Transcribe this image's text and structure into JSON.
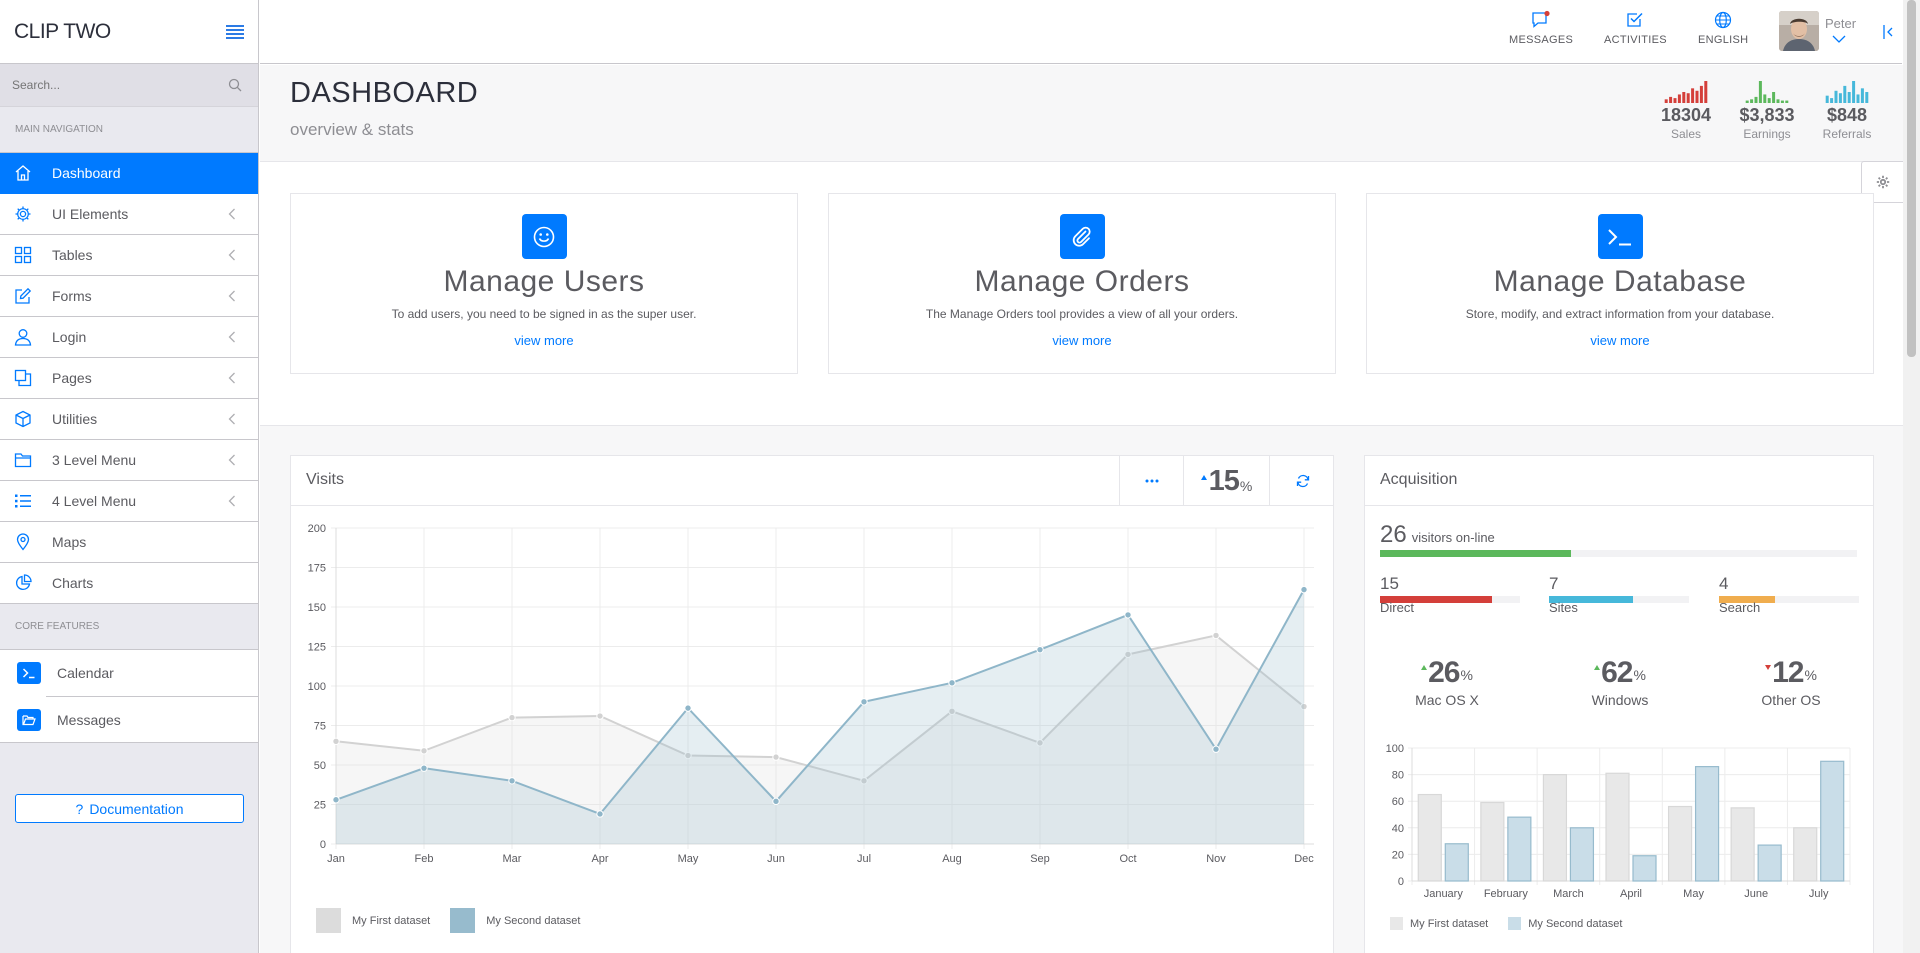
{
  "app": {
    "brand": "CLIP TWO"
  },
  "sidebar": {
    "search_placeholder": "Search...",
    "main_nav_heading": "MAIN NAVIGATION",
    "items": [
      {
        "label": "Dashboard",
        "icon": "home-icon",
        "active": true
      },
      {
        "label": "UI Elements",
        "icon": "gear-icon"
      },
      {
        "label": "Tables",
        "icon": "grid-icon"
      },
      {
        "label": "Forms",
        "icon": "pencil-icon"
      },
      {
        "label": "Login",
        "icon": "user-icon"
      },
      {
        "label": "Pages",
        "icon": "pages-icon"
      },
      {
        "label": "Utilities",
        "icon": "cube-icon"
      },
      {
        "label": "3 Level Menu",
        "icon": "folder-icon"
      },
      {
        "label": "4 Level Menu",
        "icon": "list-icon"
      },
      {
        "label": "Maps",
        "icon": "map-pin-icon"
      },
      {
        "label": "Charts",
        "icon": "pie-chart-icon"
      }
    ],
    "core_heading": "CORE FEATURES",
    "core_items": [
      {
        "label": "Calendar",
        "icon": "terminal-icon"
      },
      {
        "label": "Messages",
        "icon": "folder-open-icon"
      }
    ],
    "doc_button": "Documentation"
  },
  "topbar": {
    "messages": "MESSAGES",
    "activities": "ACTIVITIES",
    "english": "ENGLISH",
    "user_name": "Peter"
  },
  "page": {
    "title": "DASHBOARD",
    "subtitle": "overview & stats",
    "mini_stats": [
      {
        "value": "18304",
        "label": "Sales",
        "color": "#d43f3a",
        "bars": [
          3,
          5,
          4,
          7,
          9,
          8,
          12,
          10,
          14,
          18
        ]
      },
      {
        "value": "$3,833",
        "label": "Earnings",
        "color": "#5cb85c",
        "bars": [
          2,
          3,
          5,
          18,
          7,
          4,
          9,
          3,
          2,
          2
        ]
      },
      {
        "value": "$848",
        "label": "Referrals",
        "color": "#46b8da",
        "bars": [
          6,
          4,
          10,
          8,
          14,
          9,
          18,
          7,
          12,
          9
        ]
      }
    ]
  },
  "features": [
    {
      "title": "Manage Users",
      "desc": "To add users, you need to be signed in as the super user.",
      "link": "view more",
      "icon": "smile-icon"
    },
    {
      "title": "Manage Orders",
      "desc": "The Manage Orders tool provides a view of all your orders.",
      "link": "view more",
      "icon": "paperclip-icon"
    },
    {
      "title": "Manage Database",
      "desc": "Store, modify, and extract information from your database.",
      "link": "view more",
      "icon": "terminal-icon"
    }
  ],
  "visits": {
    "title": "Visits",
    "percent": "15",
    "percent_sign": "%"
  },
  "acquisition": {
    "title": "Acquisition",
    "online_count": "26",
    "online_label": "visitors on-line",
    "online_fraction": 0.4,
    "sources": [
      {
        "value": "15",
        "label": "Direct",
        "color": "#d43f3a",
        "fraction": 0.8
      },
      {
        "value": "7",
        "label": "Sites",
        "color": "#46b8da",
        "fraction": 0.6
      },
      {
        "value": "4",
        "label": "Search",
        "color": "#f0ad4e",
        "fraction": 0.4
      }
    ],
    "os": [
      {
        "value": "26",
        "pct": "%",
        "label": "Mac OS X",
        "trend": "up"
      },
      {
        "value": "62",
        "pct": "%",
        "label": "Windows",
        "trend": "up"
      },
      {
        "value": "12",
        "pct": "%",
        "label": "Other OS",
        "trend": "down"
      }
    ]
  },
  "chart_data": [
    {
      "type": "line",
      "categories": [
        "Jan",
        "Feb",
        "Mar",
        "Apr",
        "May",
        "Jun",
        "Jul",
        "Aug",
        "Sep",
        "Oct",
        "Nov",
        "Dec"
      ],
      "series": [
        {
          "name": "My First dataset",
          "values": [
            65,
            59,
            80,
            81,
            56,
            55,
            40,
            84,
            64,
            120,
            132,
            87
          ],
          "color": "#d2d2d2"
        },
        {
          "name": "My Second dataset",
          "values": [
            28,
            48,
            40,
            19,
            86,
            27,
            90,
            102,
            123,
            145,
            60,
            161
          ],
          "color": "#8fb6c9"
        }
      ],
      "yticks": [
        "0",
        "25",
        "50",
        "75",
        "100",
        "125",
        "150",
        "175",
        "200"
      ],
      "ylim": [
        0,
        200
      ],
      "grid": true,
      "legend": "bottom-left"
    },
    {
      "type": "bar",
      "categories": [
        "January",
        "February",
        "March",
        "April",
        "May",
        "June",
        "July"
      ],
      "series": [
        {
          "name": "My First dataset",
          "values": [
            65,
            59,
            80,
            81,
            56,
            55,
            40
          ],
          "color": "#e8e8e8"
        },
        {
          "name": "My Second dataset",
          "values": [
            28,
            48,
            40,
            19,
            86,
            27,
            90
          ],
          "color": "#c9dde8"
        }
      ],
      "yticks": [
        "0",
        "20",
        "40",
        "60",
        "80",
        "100"
      ],
      "ylim": [
        0,
        100
      ],
      "grid": true,
      "legend": "bottom-left"
    }
  ]
}
